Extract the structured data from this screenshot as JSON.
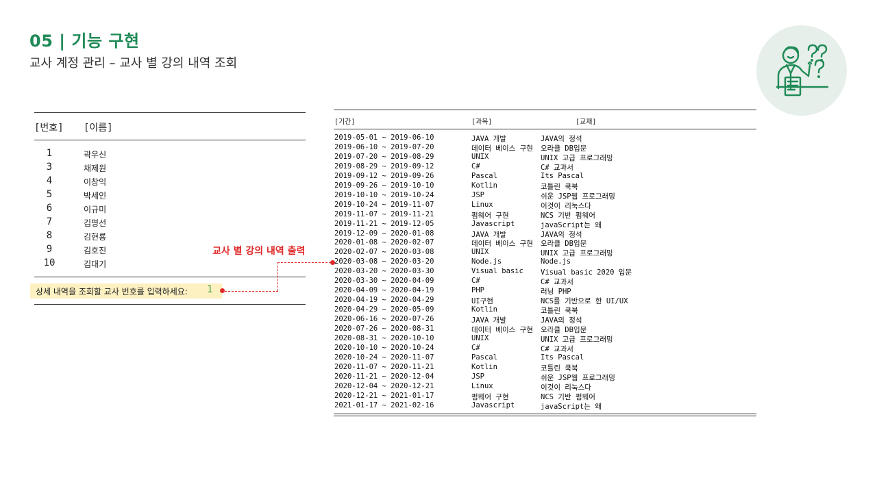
{
  "header": {
    "title": "05 | 기능 구현",
    "subtitle": "교사 계정 관리 – 교사 별 강의 내역 조회"
  },
  "left_panel": {
    "col_number": "[번호]",
    "col_name": "[이름]",
    "teachers": [
      {
        "number": "1",
        "name": "곽우신"
      },
      {
        "number": "3",
        "name": "채제원"
      },
      {
        "number": "4",
        "name": "이창익"
      },
      {
        "number": "5",
        "name": "박세인"
      },
      {
        "number": "6",
        "name": "이규미"
      },
      {
        "number": "7",
        "name": "김명선"
      },
      {
        "number": "8",
        "name": "김현룡"
      },
      {
        "number": "9",
        "name": "김호진"
      },
      {
        "number": "10",
        "name": "김대기"
      }
    ],
    "prompt": "상세 내역을 조회할 교사 번호를 입력하세요:",
    "prompt_value": "1"
  },
  "annotation": {
    "label": "교사 별 강의 내역 출력"
  },
  "table": {
    "col_period": "[기간]",
    "col_subject": "[과목]",
    "col_textbook": "[교재]",
    "rows": [
      {
        "period": "2019-05-01 ~ 2019-06-10",
        "subject": "JAVA 개발",
        "textbook": "JAVA의 정석"
      },
      {
        "period": "2019-06-10 ~ 2019-07-20",
        "subject": "데이터 베이스 구현",
        "textbook": "오라클 DB입문"
      },
      {
        "period": "2019-07-20 ~ 2019-08-29",
        "subject": "UNIX",
        "textbook": "UNIX 고급 프로그래밍"
      },
      {
        "period": "2019-08-29 ~ 2019-09-12",
        "subject": "C#",
        "textbook": "C# 교과서"
      },
      {
        "period": "2019-09-12 ~ 2019-09-26",
        "subject": "Pascal",
        "textbook": "Its Pascal"
      },
      {
        "period": "2019-09-26 ~ 2019-10-10",
        "subject": "Kotlin",
        "textbook": "코틀린 쿡북"
      },
      {
        "period": "2019-10-10 ~ 2019-10-24",
        "subject": "JSP",
        "textbook": "쉬운 JSP웹 프로그래밍"
      },
      {
        "period": "2019-10-24 ~ 2019-11-07",
        "subject": "Linux",
        "textbook": "이것이 리눅스다"
      },
      {
        "period": "2019-11-07 ~ 2019-11-21",
        "subject": "펌웨어 구현",
        "textbook": "NCS 기반 펌웨어"
      },
      {
        "period": "2019-11-21 ~ 2019-12-05",
        "subject": "Javascript",
        "textbook": "javaScript는 왜"
      },
      {
        "period": "2019-12-09 ~ 2020-01-08",
        "subject": "JAVA 개발",
        "textbook": "JAVA의 정석"
      },
      {
        "period": "2020-01-08 ~ 2020-02-07",
        "subject": "데이터 베이스 구현",
        "textbook": "오라클 DB입문"
      },
      {
        "period": "2020-02-07 ~ 2020-03-08",
        "subject": "UNIX",
        "textbook": "UNIX 고급 프로그래밍"
      },
      {
        "period": "2020-03-08 ~ 2020-03-20",
        "subject": "Node.js",
        "textbook": "Node.js"
      },
      {
        "period": "2020-03-20 ~ 2020-03-30",
        "subject": "Visual basic",
        "textbook": "Visual basic 2020 입문"
      },
      {
        "period": "2020-03-30 ~ 2020-04-09",
        "subject": "C#",
        "textbook": "C# 교과서"
      },
      {
        "period": "2020-04-09 ~ 2020-04-19",
        "subject": "PHP",
        "textbook": "러닝 PHP"
      },
      {
        "period": "2020-04-19 ~ 2020-04-29",
        "subject": "UI구현",
        "textbook": "NCS를 기반으로 한 UI/UX"
      },
      {
        "period": "2020-04-29 ~ 2020-05-09",
        "subject": "Kotlin",
        "textbook": "코틀린 쿡북"
      },
      {
        "period": "2020-06-16 ~ 2020-07-26",
        "subject": "JAVA 개발",
        "textbook": "JAVA의 정석"
      },
      {
        "period": "2020-07-26 ~ 2020-08-31",
        "subject": "데이터 베이스 구현",
        "textbook": "오라클 DB입문"
      },
      {
        "period": "2020-08-31 ~ 2020-10-10",
        "subject": "UNIX",
        "textbook": "UNIX 고급 프로그래밍"
      },
      {
        "period": "2020-10-10 ~ 2020-10-24",
        "subject": "C#",
        "textbook": "C# 교과서"
      },
      {
        "period": "2020-10-24 ~ 2020-11-07",
        "subject": "Pascal",
        "textbook": "Its Pascal"
      },
      {
        "period": "2020-11-07 ~ 2020-11-21",
        "subject": "Kotlin",
        "textbook": "코틀린 쿡북"
      },
      {
        "period": "2020-11-21 ~ 2020-12-04",
        "subject": "JSP",
        "textbook": "쉬운 JSP웹 프로그래밍"
      },
      {
        "period": "2020-12-04 ~ 2020-12-21",
        "subject": "Linux",
        "textbook": "이것이 리눅스다"
      },
      {
        "period": "2020-12-21 ~ 2021-01-17",
        "subject": "펌웨어 구현",
        "textbook": "NCS 기반 펌웨어"
      },
      {
        "period": "2021-01-17 ~ 2021-02-16",
        "subject": "Javascript",
        "textbook": "javaScript는 왜"
      }
    ]
  },
  "icon": {
    "name": "confused-person-question-icon",
    "color": "#1f8a57",
    "bg": "#e6efe9"
  },
  "colors": {
    "accent": "#1f8a57",
    "highlight": "#e02a2a",
    "prompt_bg": "#fdf1c2",
    "input_value": "#3a9e3a"
  }
}
